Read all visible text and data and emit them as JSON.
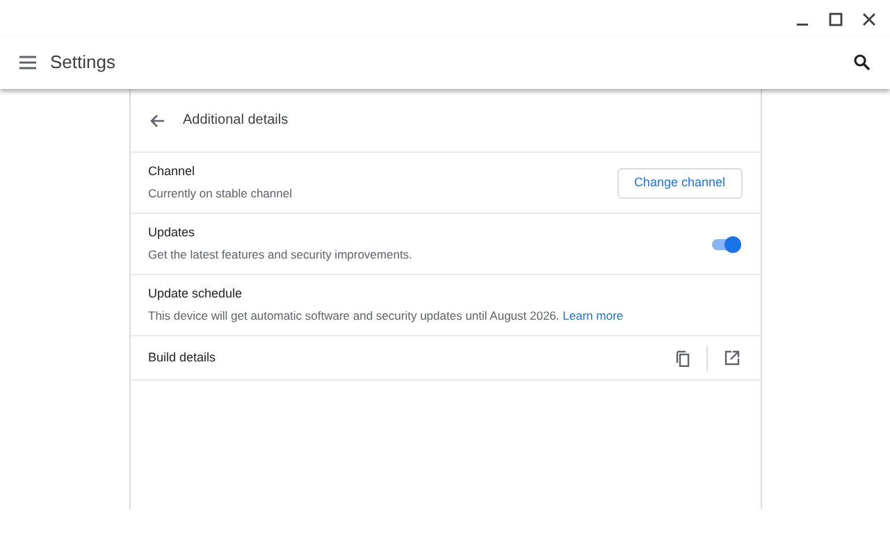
{
  "header": {
    "title": "Settings"
  },
  "page": {
    "title": "Additional details"
  },
  "rows": [
    {
      "kind": "button",
      "label": "Channel",
      "description": "Currently on stable channel",
      "button": "Change channel"
    },
    {
      "kind": "toggle",
      "label": "Updates",
      "description": "Get the latest features and security improvements.",
      "on": true
    },
    {
      "kind": "text",
      "label": "Update schedule",
      "description": "This device will get automatic software and security updates until August 2026.",
      "link": "Learn more"
    },
    {
      "kind": "icons",
      "label": "Build details"
    }
  ]
}
